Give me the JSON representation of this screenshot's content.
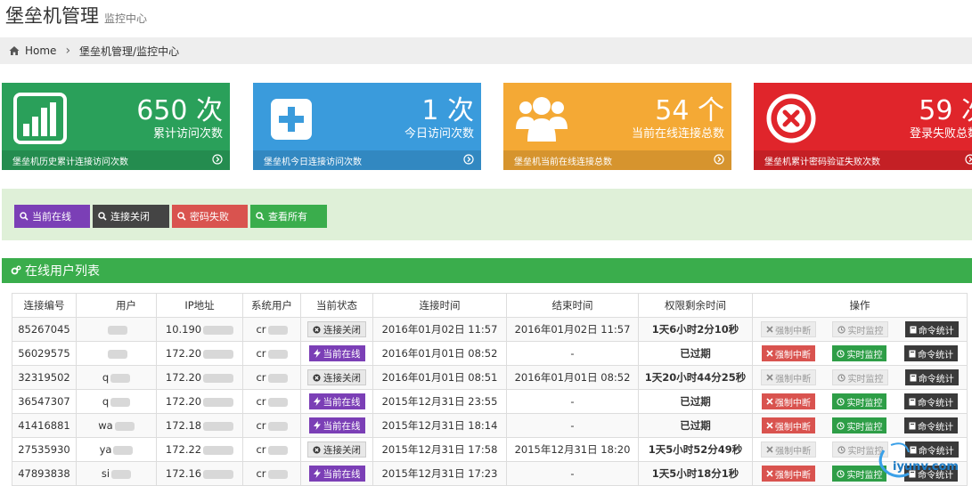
{
  "header": {
    "title": "堡垒机管理",
    "subtitle": "监控中心"
  },
  "breadcrumb": {
    "home": "Home",
    "current": "堡垒机管理/监控中心"
  },
  "stats": [
    {
      "value": "650 次",
      "label": "累计访问次数",
      "footer": "堡垒机历史累计连接访问次数",
      "color": "#2aa05a",
      "icon": "bar-chart-icon"
    },
    {
      "value": "1 次",
      "label": "今日访问次数",
      "footer": "堡垒机今日连接访问次数",
      "color": "#3a9bdc",
      "icon": "plus-square-icon"
    },
    {
      "value": "54 个",
      "label": "当前在线连接总数",
      "footer": "堡垒机当前在线连接总数",
      "color": "#f4a935",
      "icon": "users-icon"
    },
    {
      "value": "59 次",
      "label": "登录失败总数",
      "footer": "堡垒机累计密码验证失败次数",
      "color": "#e0252b",
      "icon": "times-circle-icon"
    }
  ],
  "filters": [
    {
      "label": "当前在线",
      "color": "#7b3fb6"
    },
    {
      "label": "连接关闭",
      "color": "#444444"
    },
    {
      "label": "密码失败",
      "color": "#d9534f"
    },
    {
      "label": "查看所有",
      "color": "#3aad4c"
    }
  ],
  "panel": {
    "title": "在线用户列表"
  },
  "table": {
    "columns": [
      "连接编号",
      "用户",
      "IP地址",
      "系统用户",
      "当前状态",
      "连接时间",
      "结束时间",
      "权限剩余时间",
      "操作"
    ],
    "status_labels": {
      "closed": "连接关闭",
      "online": "当前在线"
    },
    "action_labels": {
      "kill": "强制中断",
      "monitor": "实时监控",
      "commands": "命令统计"
    },
    "rows": [
      {
        "id": "85267045",
        "user": "",
        "ip": "10.190",
        "sys": "cr",
        "status": "closed",
        "start": "2016年01月02日 11:57",
        "end": "2016年01月02日 11:57",
        "remain": "1天6小时2分10秒",
        "active": false
      },
      {
        "id": "56029575",
        "user": "",
        "ip": "172.20",
        "sys": "cr",
        "status": "online",
        "start": "2016年01月01日 08:52",
        "end": "-",
        "remain": "已过期",
        "active": true
      },
      {
        "id": "32319502",
        "user": "q",
        "ip": "172.20",
        "sys": "cr",
        "status": "closed",
        "start": "2016年01月01日 08:51",
        "end": "2016年01月01日 08:52",
        "remain": "1天20小时44分25秒",
        "active": false
      },
      {
        "id": "36547307",
        "user": "q",
        "ip": "172.20",
        "sys": "cr",
        "status": "online",
        "start": "2015年12月31日 23:55",
        "end": "-",
        "remain": "已过期",
        "active": true
      },
      {
        "id": "41416881",
        "user": "wa",
        "ip": "172.18",
        "sys": "cr",
        "status": "online",
        "start": "2015年12月31日 18:14",
        "end": "-",
        "remain": "已过期",
        "active": true
      },
      {
        "id": "27535930",
        "user": "ya",
        "ip": "172.22",
        "sys": "cr",
        "status": "closed",
        "start": "2015年12月31日 17:58",
        "end": "2015年12月31日 18:20",
        "remain": "1天5小时52分49秒",
        "active": false
      },
      {
        "id": "47893838",
        "user": "si",
        "ip": "172.16",
        "sys": "cr",
        "status": "online",
        "start": "2015年12月31日 17:23",
        "end": "-",
        "remain": "1天5小时18分1秒",
        "active": true
      }
    ]
  },
  "watermark": {
    "text": "iyunv.com"
  }
}
